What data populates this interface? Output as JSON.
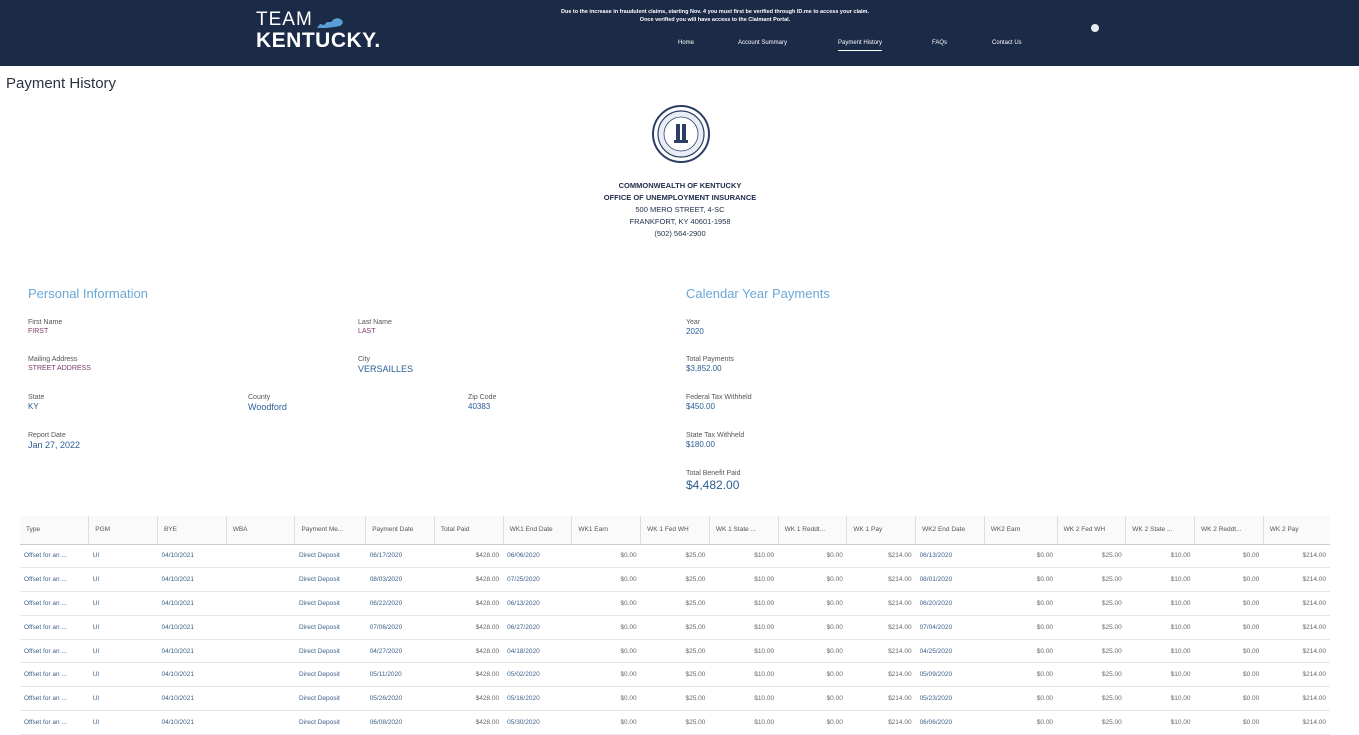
{
  "header": {
    "logo_top": "TEAM",
    "logo_bottom": "KENTUCKY.",
    "notice_line1": "Due to the increase in fraudulent claims, starting Nov. 4 you must first be verified through ID.me to access your claim.",
    "notice_line2": "Once verified you will have access to the Claimant Portal.",
    "nav": [
      {
        "label": "Home",
        "active": false
      },
      {
        "label": "Account Summary",
        "active": false
      },
      {
        "label": "Payment History",
        "active": true
      },
      {
        "label": "FAQs",
        "active": false
      },
      {
        "label": "Contact Us",
        "active": false
      }
    ]
  },
  "page_title": "Payment History",
  "office": {
    "line1": "COMMONWEALTH OF KENTUCKY",
    "line2": "OFFICE OF UNEMPLOYMENT INSURANCE",
    "line3": "500 MERO STREET, 4-SC",
    "line4": "FRANKFORT, KY 40601-1958",
    "line5": "(502) 564-2900"
  },
  "personal": {
    "title": "Personal Information",
    "first_name_label": "First Name",
    "first_name": "FIRST",
    "last_name_label": "Last Name",
    "last_name": "LAST",
    "mailing_label": "Mailing Address",
    "mailing": "STREET ADDRESS",
    "city_label": "City",
    "city": "VERSAILLES",
    "state_label": "State",
    "state": "KY",
    "county_label": "County",
    "county": "Woodford",
    "zip_label": "Zip Code",
    "zip": "40383",
    "report_label": "Report Date",
    "report": "Jan 27, 2022"
  },
  "calendar": {
    "title": "Calendar Year Payments",
    "year_label": "Year",
    "year": "2020",
    "total_label": "Total Payments",
    "total": "$3,852.00",
    "fed_label": "Federal Tax Withheld",
    "fed": "$450.00",
    "state_label": "State Tax Withheld",
    "state": "$180.00",
    "benefit_label": "Total Benefit Paid",
    "benefit": "$4,482.00"
  },
  "table": {
    "columns": [
      "Type",
      "PGM",
      "BYE",
      "WBA",
      "Payment Me...",
      "Payment Date",
      "Total Paid",
      "WK1 End Date",
      "WK1 Earn",
      "WK 1 Fed WH",
      "WK 1 State ...",
      "WK 1 Reddt...",
      "WK 1 Pay",
      "WK2 End Date",
      "WK2 Earn",
      "WK 2 Fed WH",
      "WK 2 State ...",
      "WK 2 Reddt...",
      "WK 2 Pay"
    ],
    "rows": [
      [
        "Offset for an ...",
        "UI",
        "04/10/2021",
        "",
        "Direct Deposit",
        "06/17/2020",
        "$428.00",
        "06/06/2020",
        "$0.00",
        "$25.00",
        "$10.00",
        "$0.00",
        "$214.00",
        "06/13/2020",
        "$0.00",
        "$25.00",
        "$10.00",
        "$0.00",
        "$214.00"
      ],
      [
        "Offset for an ...",
        "UI",
        "04/10/2021",
        "",
        "Direct Deposit",
        "08/03/2020",
        "$428.00",
        "07/25/2020",
        "$0.00",
        "$25.00",
        "$10.00",
        "$0.00",
        "$214.00",
        "08/01/2020",
        "$0.00",
        "$25.00",
        "$10.00",
        "$0.00",
        "$214.00"
      ],
      [
        "Offset for an ...",
        "UI",
        "04/10/2021",
        "",
        "Direct Deposit",
        "06/22/2020",
        "$428.00",
        "06/13/2020",
        "$0.00",
        "$25.00",
        "$10.00",
        "$0.00",
        "$214.00",
        "06/20/2020",
        "$0.00",
        "$25.00",
        "$10.00",
        "$0.00",
        "$214.00"
      ],
      [
        "Offset for an ...",
        "UI",
        "04/10/2021",
        "",
        "Direct Deposit",
        "07/06/2020",
        "$428.00",
        "06/27/2020",
        "$0.00",
        "$25.00",
        "$10.00",
        "$0.00",
        "$214.00",
        "07/04/2020",
        "$0.00",
        "$25.00",
        "$10.00",
        "$0.00",
        "$214.00"
      ],
      [
        "Offset for an ...",
        "UI",
        "04/10/2021",
        "",
        "Direct Deposit",
        "04/27/2020",
        "$428.00",
        "04/18/2020",
        "$0.00",
        "$25.00",
        "$10.00",
        "$0.00",
        "$214.00",
        "04/25/2020",
        "$0.00",
        "$25.00",
        "$10.00",
        "$0.00",
        "$214.00"
      ],
      [
        "Offset for an ...",
        "UI",
        "04/10/2021",
        "",
        "Direct Deposit",
        "05/11/2020",
        "$428.00",
        "05/02/2020",
        "$0.00",
        "$25.00",
        "$10.00",
        "$0.00",
        "$214.00",
        "05/09/2020",
        "$0.00",
        "$25.00",
        "$10.00",
        "$0.00",
        "$214.00"
      ],
      [
        "Offset for an ...",
        "UI",
        "04/10/2021",
        "",
        "Direct Deposit",
        "05/26/2020",
        "$428.00",
        "05/16/2020",
        "$0.00",
        "$25.00",
        "$10.00",
        "$0.00",
        "$214.00",
        "05/23/2020",
        "$0.00",
        "$25.00",
        "$10.00",
        "$0.00",
        "$214.00"
      ],
      [
        "Offset for an ...",
        "UI",
        "04/10/2021",
        "",
        "Direct Deposit",
        "06/08/2020",
        "$428.00",
        "05/30/2020",
        "$0.00",
        "$25.00",
        "$10.00",
        "$0.00",
        "$214.00",
        "06/06/2020",
        "$0.00",
        "$25.00",
        "$10.00",
        "$0.00",
        "$214.00"
      ]
    ]
  },
  "icons": {
    "user": "user-avatar-icon",
    "seal": "kentucky-seal-icon",
    "logo": "kentucky-state-shape-icon"
  },
  "colors": {
    "header_bg": "#1b2a47",
    "section_title": "#6aa8d8",
    "value_blue": "#2a5e93",
    "value_purple": "#7a3d6b"
  }
}
